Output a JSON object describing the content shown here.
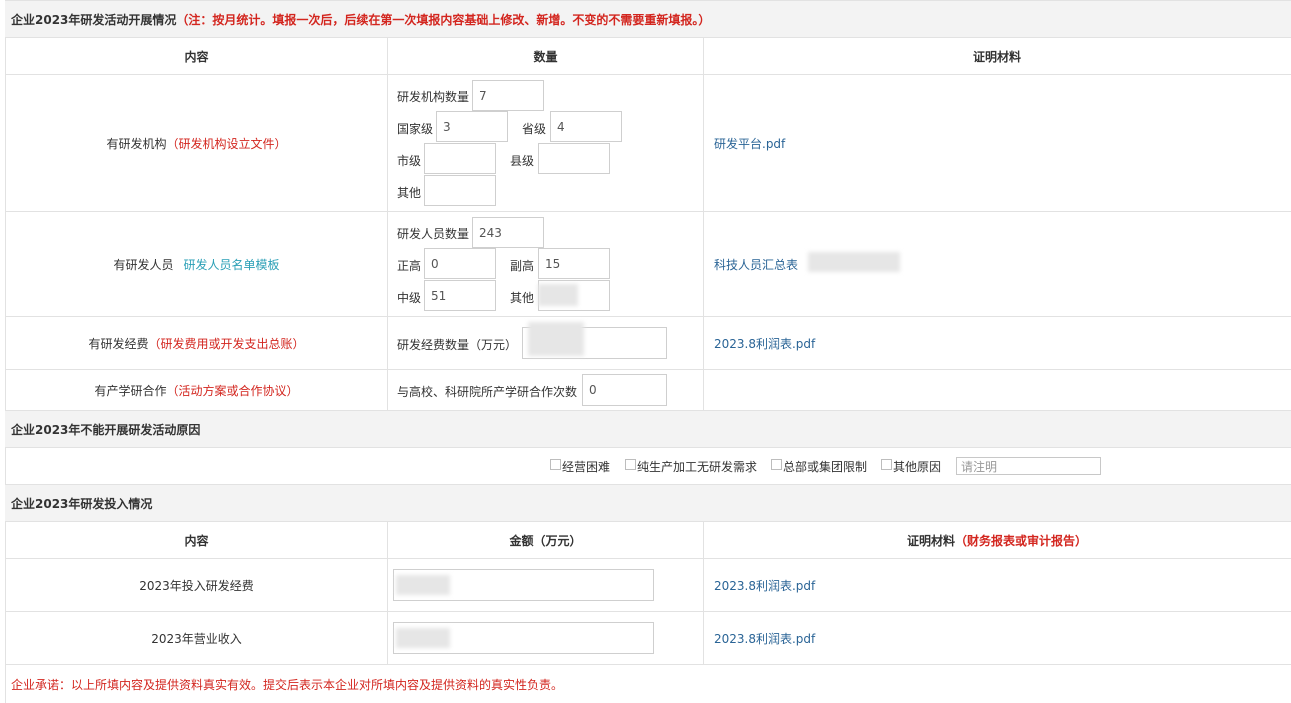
{
  "section1": {
    "title": "企业2023年研发活动开展情况",
    "note": "（注：按月统计。填报一次后，后续在第一次填报内容基础上修改、新增。不变的不需要重新填报。）",
    "headers": {
      "content": "内容",
      "quantity": "数量",
      "proof": "证明材料"
    },
    "rnd_org": {
      "label": "有研发机构",
      "link": "（研发机构设立文件）",
      "count_label": "研发机构数量",
      "count_value": "7",
      "national_label": "国家级",
      "national_value": "3",
      "provincial_label": "省级",
      "provincial_value": "4",
      "city_label": "市级",
      "city_value": "",
      "county_label": "县级",
      "county_value": "",
      "other_label": "其他",
      "other_value": "",
      "proof_file": "研发平台.pdf"
    },
    "rnd_staff": {
      "label": "有研发人员",
      "link": "研发人员名单模板",
      "count_label": "研发人员数量",
      "count_value": "243",
      "senior_label": "正高",
      "senior_value": "0",
      "vice_senior_label": "副高",
      "vice_senior_value": "15",
      "mid_label": "中级",
      "mid_value": "51",
      "other_label": "其他",
      "other_value": "",
      "proof_file": "科技人员汇总表"
    },
    "rnd_funds": {
      "label": "有研发经费",
      "link": "（研发费用或开发支出总账）",
      "amount_label": "研发经费数量（万元）",
      "amount_value": "",
      "proof_file": "2023.8利润表.pdf"
    },
    "cooperation": {
      "label": "有产学研合作",
      "link": "（活动方案或合作协议）",
      "count_label": "与高校、科研院所产学研合作次数",
      "count_value": "0"
    }
  },
  "section2": {
    "title": "企业2023年不能开展研发活动原因",
    "reasons": [
      "经营困难",
      "纯生产加工无研发需求",
      "总部或集团限制",
      "其他原因"
    ],
    "other_placeholder": "请注明"
  },
  "section3": {
    "title": "企业2023年研发投入情况",
    "headers": {
      "content": "内容",
      "amount": "金额（万元）",
      "proof": "证明材料",
      "proof_note": "（财务报表或审计报告）"
    },
    "rows": [
      {
        "label": "2023年投入研发经费",
        "value": "",
        "proof_file": "2023.8利润表.pdf"
      },
      {
        "label": "2023年营业收入",
        "value": "",
        "proof_file": "2023.8利润表.pdf"
      }
    ]
  },
  "footer": "企业承诺：以上所填内容及提供资料真实有效。提交后表示本企业对所填内容及提供资料的真实性负责。"
}
